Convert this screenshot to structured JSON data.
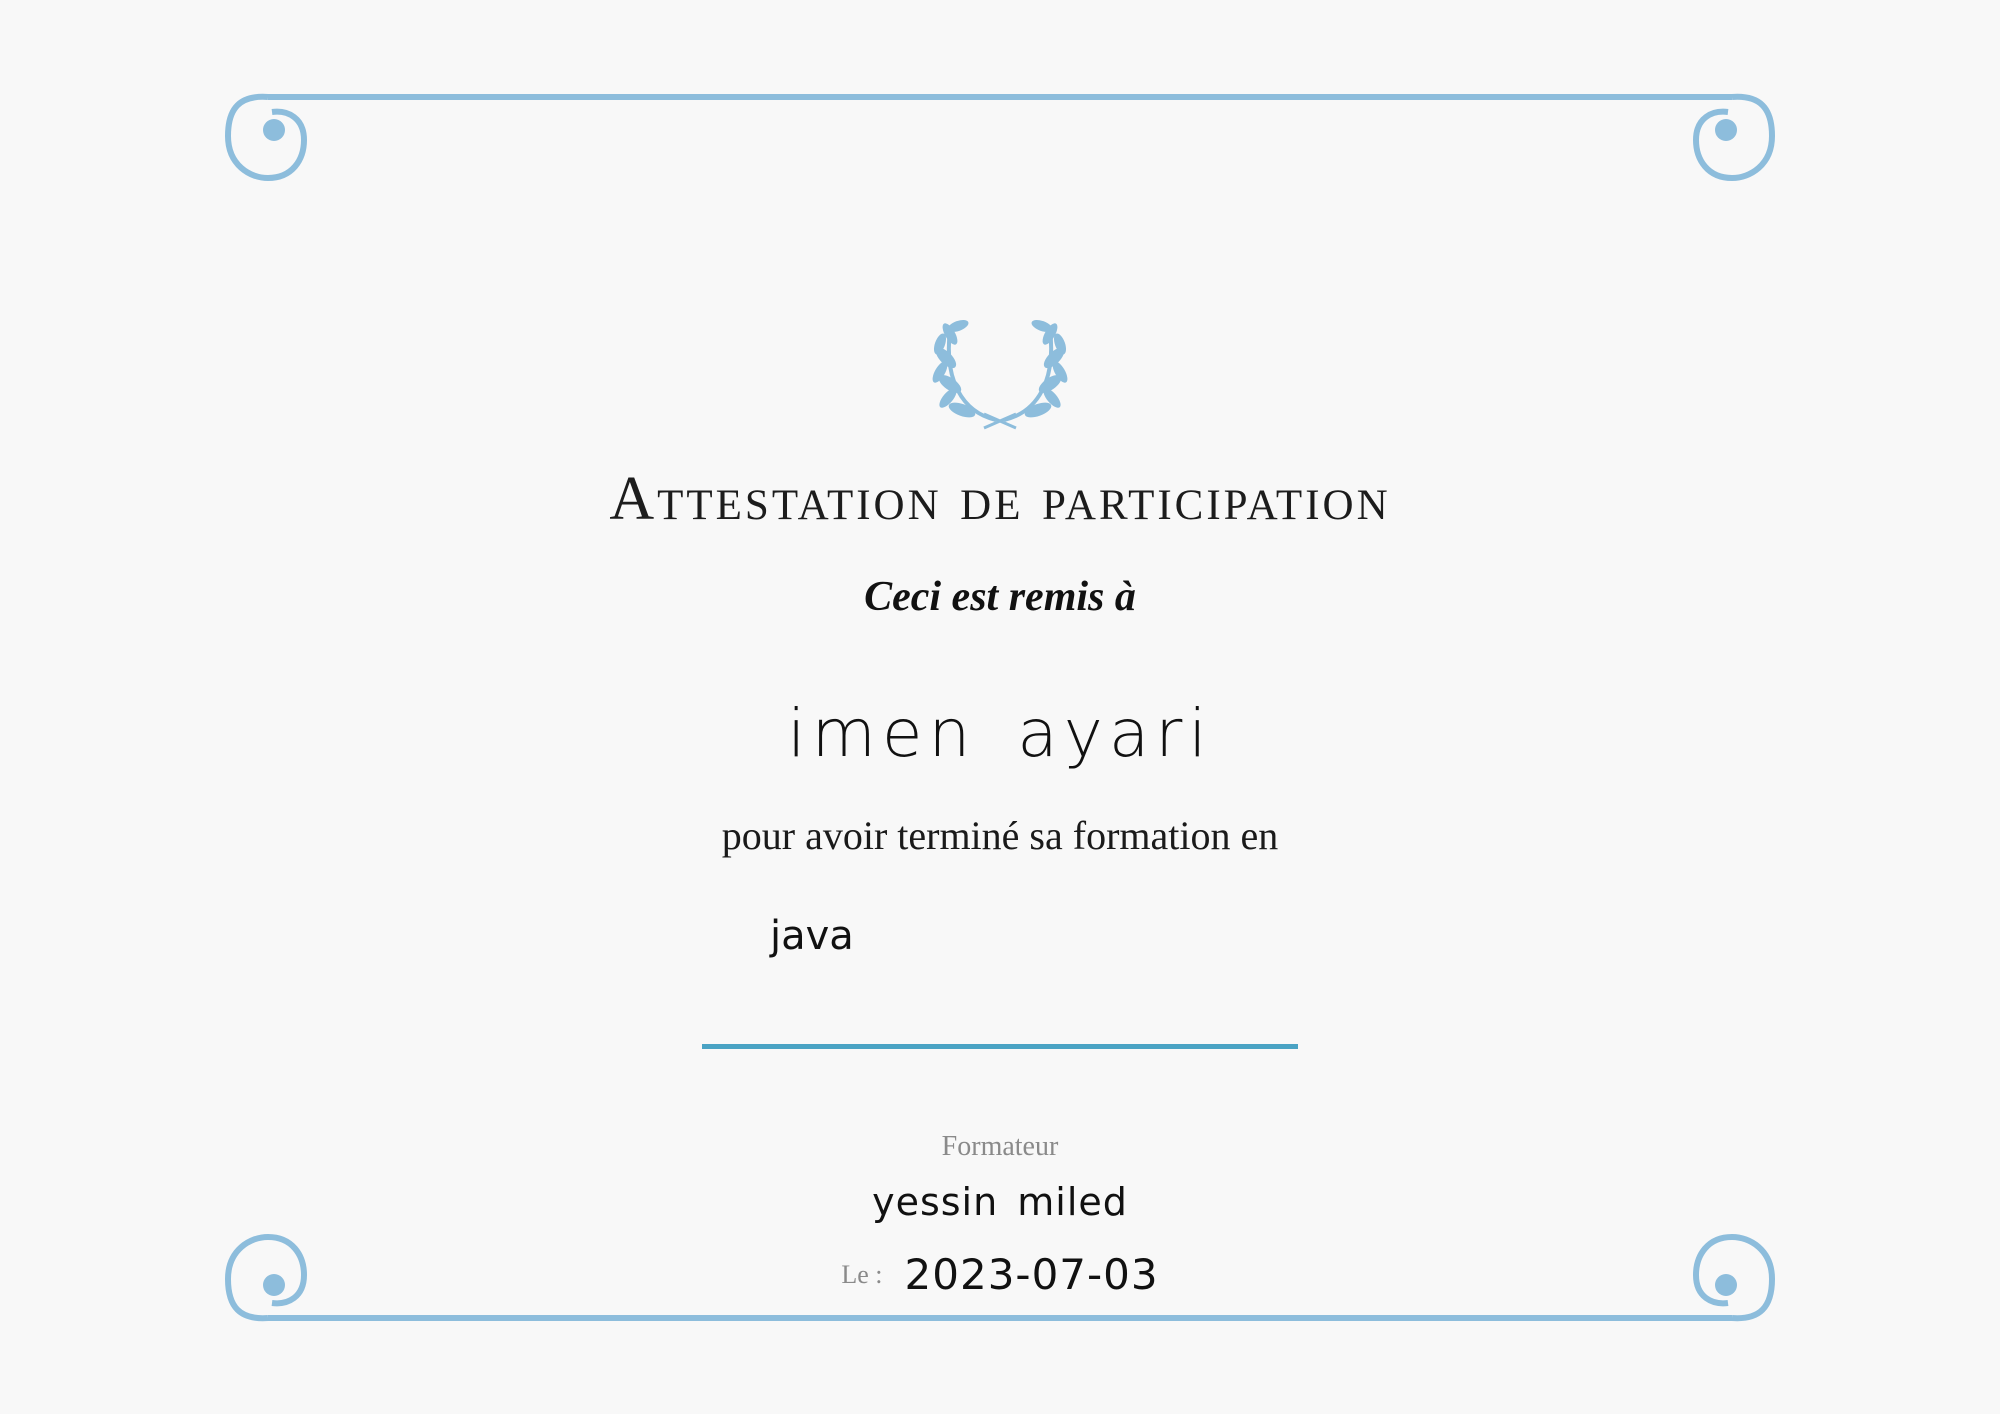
{
  "certificate": {
    "title": "Attestation de participation",
    "subtitle": "Ceci est remis à",
    "recipient": "imen  ayari",
    "reason": "pour avoir terminé sa formation en",
    "course": "java",
    "trainer_label": "Formateur",
    "trainer_name": "yessin  miled",
    "date_label": "Le :",
    "date_value": "2023-07-03"
  },
  "colors": {
    "frame": "#8dbddc",
    "divider": "#4aa3c4",
    "laurel": "#8dbddc",
    "background": "#f8f8f8"
  },
  "icons": {
    "emblem": "laurel-wreath-icon",
    "corners": "scroll-curl-icon"
  }
}
